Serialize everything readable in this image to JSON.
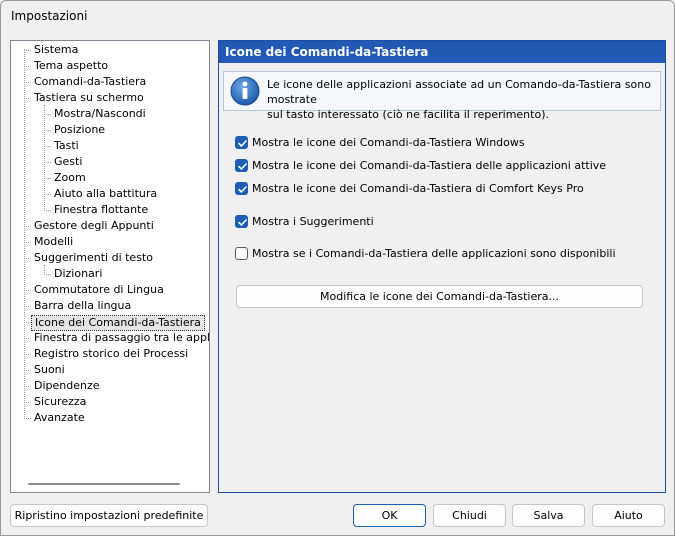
{
  "window": {
    "title": "Impostazioni"
  },
  "tree": {
    "items": [
      {
        "label": "Sistema",
        "level": 0
      },
      {
        "label": "Tema aspetto",
        "level": 0
      },
      {
        "label": "Comandi-da-Tastiera",
        "level": 0
      },
      {
        "label": "Tastiera su schermo",
        "level": 0
      },
      {
        "label": "Mostra/Nascondi",
        "level": 1
      },
      {
        "label": "Posizione",
        "level": 1
      },
      {
        "label": "Tasti",
        "level": 1
      },
      {
        "label": "Gesti",
        "level": 1
      },
      {
        "label": "Zoom",
        "level": 1
      },
      {
        "label": "Aiuto alla battitura",
        "level": 1
      },
      {
        "label": "Finestra flottante",
        "level": 1
      },
      {
        "label": "Gestore degli Appunti",
        "level": 0
      },
      {
        "label": "Modelli",
        "level": 0
      },
      {
        "label": "Suggerimenti di testo",
        "level": 0
      },
      {
        "label": "Dizionari",
        "level": 1
      },
      {
        "label": "Commutatore di Lingua",
        "level": 0
      },
      {
        "label": "Barra della lingua",
        "level": 0
      },
      {
        "label": "Icone dei Comandi-da-Tastiera",
        "level": 0,
        "selected": true
      },
      {
        "label": "Finestra di passaggio tra le applicazioni",
        "level": 0
      },
      {
        "label": "Registro storico dei Processi",
        "level": 0
      },
      {
        "label": "Suoni",
        "level": 0
      },
      {
        "label": "Dipendenze",
        "level": 0
      },
      {
        "label": "Sicurezza",
        "level": 0
      },
      {
        "label": "Avanzate",
        "level": 0
      }
    ]
  },
  "panel": {
    "header": "Icone dei Comandi-da-Tastiera",
    "info_line1": "Le icone delle applicazioni associate ad un Comando-da-Tastiera sono mostrate",
    "info_line2": "sul tasto interessato (ciò ne facilita il reperimento).",
    "checkboxes": [
      {
        "label": "Mostra le icone dei Comandi-da-Tastiera Windows",
        "checked": true
      },
      {
        "label": "Mostra le icone dei Comandi-da-Tastiera delle applicazioni attive",
        "checked": true
      },
      {
        "label": "Mostra le icone dei Comandi-da-Tastiera di Comfort Keys Pro",
        "checked": true
      },
      {
        "label": "Mostra i Suggerimenti",
        "checked": true
      },
      {
        "label": "Mostra se i Comandi-da-Tastiera delle applicazioni sono disponibili",
        "checked": false
      }
    ],
    "edit_button": "Modifica le icone dei Comandi-da-Tastiera..."
  },
  "footer": {
    "reset_button": "Ripristino impostazioni predefinite",
    "ok_button": "OK",
    "close_button": "Chiudi",
    "save_button": "Salva",
    "help_button": "Aiuto"
  },
  "colors": {
    "accent": "#2259b4",
    "checkbox": "#1a5fb4"
  },
  "icons": {
    "info": "info-icon"
  }
}
